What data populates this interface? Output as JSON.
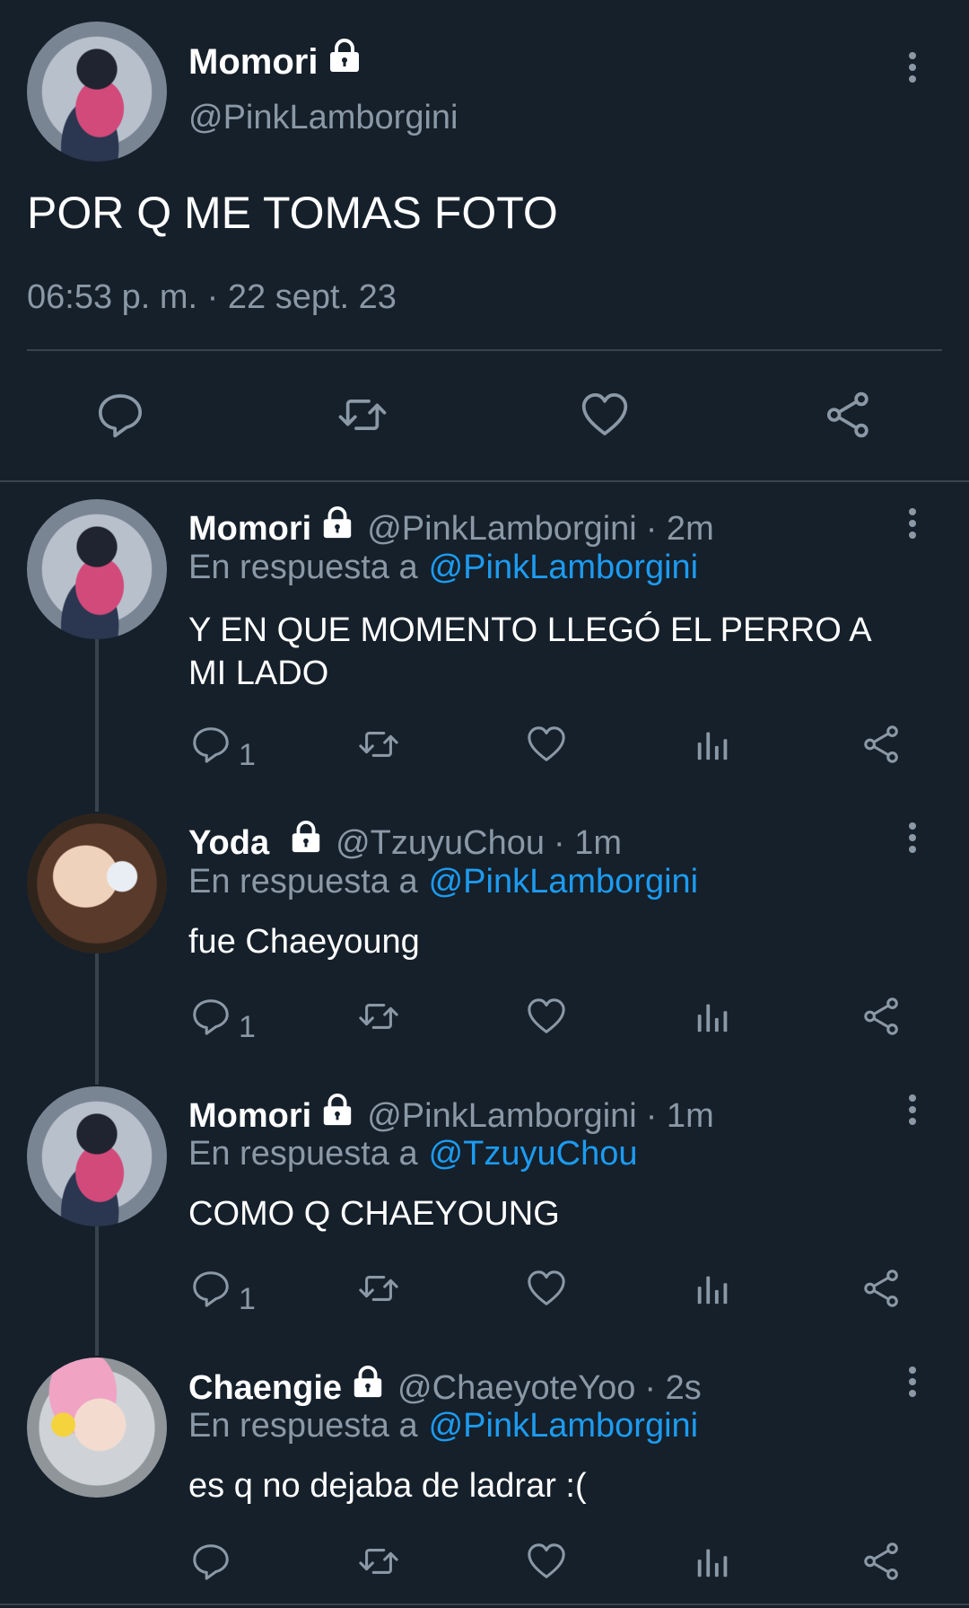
{
  "main_tweet": {
    "display_name": "Momori",
    "handle": "@PinkLamborgini",
    "text": "POR Q ME TOMAS FOTO",
    "timestamp": "06:53 p. m. · 22 sept. 23"
  },
  "replies": [
    {
      "display_name": "Momori",
      "handle": "@PinkLamborgini",
      "time": "· 2m",
      "reply_prefix": "En respuesta a",
      "reply_to": "@PinkLamborgini",
      "text_line1": "Y EN QUE MOMENTO LLEGÓ EL PERRO A",
      "text_line2": "MI LADO",
      "reply_count": "1"
    },
    {
      "display_name": "Yoda",
      "handle": "@TzuyuChou",
      "time": "· 1m",
      "reply_prefix": "En respuesta a",
      "reply_to": "@PinkLamborgini",
      "text_line1": "fue Chaeyoung",
      "reply_count": "1"
    },
    {
      "display_name": "Momori",
      "handle": "@PinkLamborgini",
      "time": "· 1m",
      "reply_prefix": "En respuesta a",
      "reply_to": "@TzuyuChou",
      "text_line1": "COMO Q CHAEYOUNG",
      "reply_count": "1"
    },
    {
      "display_name": "Chaengie",
      "handle": "@ChaeyoteYoo",
      "time": "· 2s",
      "reply_prefix": "En respuesta a",
      "reply_to": "@PinkLamborgini",
      "text_line1": "es q no dejaba de ladrar :("
    }
  ],
  "colors": {
    "background": "#15202b",
    "text": "#ffffff",
    "muted": "#8b98a5",
    "link": "#1d9bf0",
    "divider": "#38444d"
  },
  "icons": [
    "lock-icon",
    "more-options-icon",
    "reply-icon",
    "retweet-icon",
    "like-icon",
    "share-icon",
    "analytics-icon"
  ]
}
